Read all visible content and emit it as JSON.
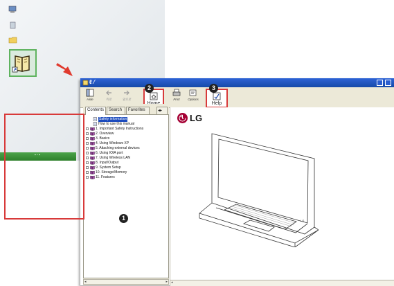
{
  "desktop": {
    "icons": [
      "computer-icon",
      "recycle-bin-icon",
      "folder-icon"
    ],
    "shortcut": "help-book-icon"
  },
  "window": {
    "title": "ℓ ⁄",
    "toolbar": {
      "hide_label": "Hide",
      "back_label": "뒤로",
      "forward_label": "앞으로",
      "home_label": "Home",
      "print_label": "Print",
      "options_label": "Options",
      "help_label": "Help"
    },
    "nav": {
      "tabs": [
        "Contents",
        "Search",
        "Favorites"
      ],
      "items": [
        {
          "label": "Safety information",
          "type": "doc",
          "selected": true
        },
        {
          "label": "How to use this manual",
          "type": "doc"
        },
        {
          "label": "1. Important Safety Instructions",
          "type": "book"
        },
        {
          "label": "2. Overview",
          "type": "book"
        },
        {
          "label": "3. Basics",
          "type": "book"
        },
        {
          "label": "4. Using Windows XP",
          "type": "book"
        },
        {
          "label": "5. Attaching external devices",
          "type": "book"
        },
        {
          "label": "6. Using IOIA port",
          "type": "book"
        },
        {
          "label": "7. Using Wireless LAN",
          "type": "book"
        },
        {
          "label": "8. Input/Output",
          "type": "book"
        },
        {
          "label": "9. System Setup",
          "type": "book"
        },
        {
          "label": "10. Storage/Memory",
          "type": "book"
        },
        {
          "label": "11. Features",
          "type": "book"
        }
      ]
    },
    "content": {
      "brand": "LG"
    }
  },
  "callouts": {
    "one": "1",
    "two": "2",
    "three": "3"
  },
  "colors": {
    "highlight": "#d83a3a",
    "titlebar": "#2258c4",
    "lg_red": "#a50034",
    "taskbar": "#3a8f38"
  }
}
